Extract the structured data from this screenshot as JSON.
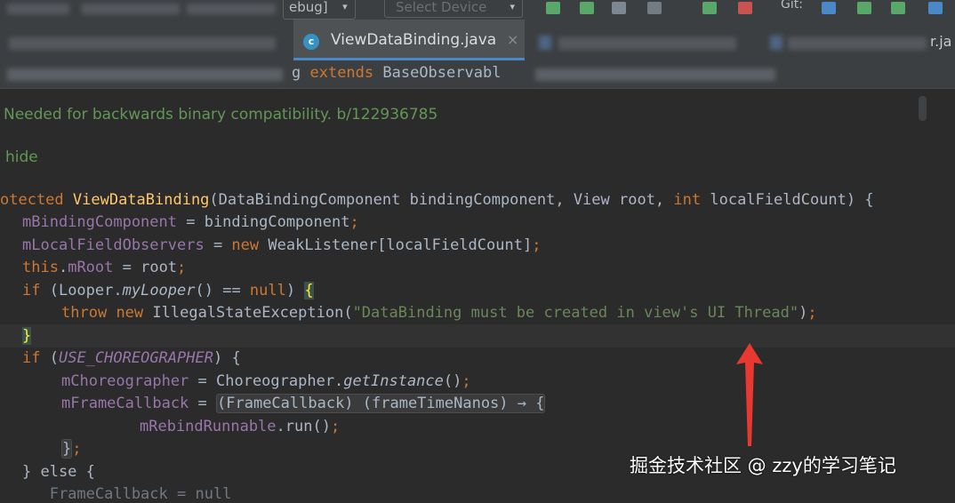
{
  "toolbar": {
    "config_label": "ebug]",
    "device_placeholder": "Select Device",
    "right_label": "Git:",
    "caret_glyph": "▾",
    "accent_colors": {
      "run": "#59a869",
      "stop": "#c75450",
      "git": "#4a88c7"
    }
  },
  "tabs": {
    "active": {
      "label": "ViewDataBinding.java",
      "icon": "c",
      "close": "×"
    },
    "right_partial_label": "r.ja"
  },
  "breadcrumb": {
    "pre": "g ",
    "keyword": "extends",
    "post": " BaseObservabl"
  },
  "editor": {
    "doc_line1": "Needed for backwards binary compatibility. b/122936785",
    "doc_line2": "hide",
    "sig": {
      "start": "otected ",
      "name": "ViewDataBinding",
      "params1": "(DataBindingComponent bindingComponent, View root, ",
      "int_kw": "int",
      "params2": " localFieldCount) {"
    },
    "l_binding": {
      "field": "mBindingComponent",
      "rest": " = bindingComponent",
      "semi": ";"
    },
    "l_observers": {
      "field": "mLocalFieldObservers",
      "eq": " = ",
      "new_kw": "new",
      "rest": " WeakListener[localFieldCount]",
      "semi": ";"
    },
    "l_root": {
      "this_kw": "this",
      "dot": ".",
      "field": "mRoot",
      "rest": " = root",
      "semi": ";"
    },
    "l_if1": {
      "if_kw": "if",
      "pre": " (Looper.",
      "method": "myLooper",
      "mid": "() == ",
      "null_kw": "null",
      "post": ") ",
      "brace": "{"
    },
    "l_throw": {
      "throw_kw": "throw",
      "sp": " ",
      "new_kw": "new",
      "cls": " IllegalStateException(",
      "str": "\"DataBinding must be created in view's UI Thread\"",
      "end": ")",
      "semi": ";"
    },
    "l_close": {
      "brace": "}"
    },
    "l_if2": {
      "if_kw": "if",
      "pre": " (",
      "const": "USE_CHOREOGRAPHER",
      "post": ") {"
    },
    "l_choreo": {
      "field": "mChoreographer",
      "pre": " = Choreographer.",
      "method": "getInstance",
      "post": "()",
      "semi": ";"
    },
    "l_frame": {
      "field": "mFrameCallback",
      "eq": " = ",
      "fold": "(FrameCallback) (frameTimeNanos) → {"
    },
    "l_rebind": {
      "field": "mRebindRunnable",
      "rest": ".run()",
      "semi": ";"
    },
    "l_fold_end": {
      "fold": "}",
      "semi": ";"
    },
    "l_else": {
      "text": "} else {"
    },
    "l_last": {
      "text": "   FrameCallback = null"
    }
  },
  "annotations": {
    "arrow_color": "#e8382f",
    "watermark": "掘金技术社区 @ zzy的学习笔记"
  }
}
